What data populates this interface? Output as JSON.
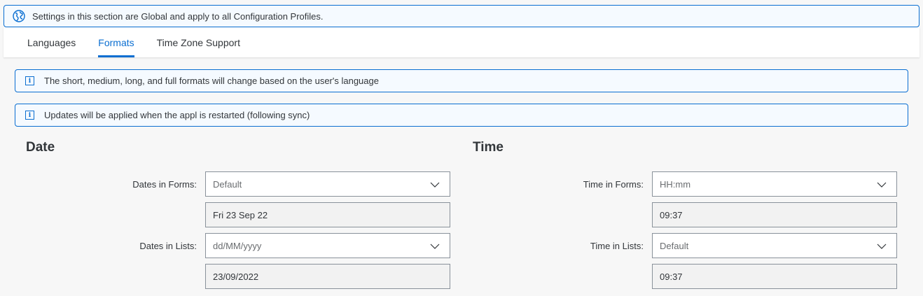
{
  "banner": {
    "text": "Settings in this section are Global and apply to all Configuration Profiles."
  },
  "tabs": [
    {
      "label": "Languages"
    },
    {
      "label": "Formats"
    },
    {
      "label": "Time Zone Support"
    }
  ],
  "info": [
    {
      "text": "The short, medium, long, and full formats will change based on the user's language"
    },
    {
      "text": "Updates will be applied when the appl is restarted (following sync)"
    }
  ],
  "date": {
    "title": "Date",
    "forms_label": "Dates in Forms:",
    "forms_value": "Default",
    "forms_preview": "Fri 23 Sep 22",
    "lists_label": "Dates in Lists:",
    "lists_value": "dd/MM/yyyy",
    "lists_preview": "23/09/2022"
  },
  "time": {
    "title": "Time",
    "forms_label": "Time in Forms:",
    "forms_value": "HH:mm",
    "forms_preview": "09:37",
    "lists_label": "Time in Lists:",
    "lists_value": "Default",
    "lists_preview": "09:37"
  },
  "icons": {
    "banner": "globe-icon",
    "info": "info-icon",
    "select": "chevron-down-icon"
  },
  "colors": {
    "accent": "#0a6ed1",
    "background": "#f7f7f7"
  }
}
